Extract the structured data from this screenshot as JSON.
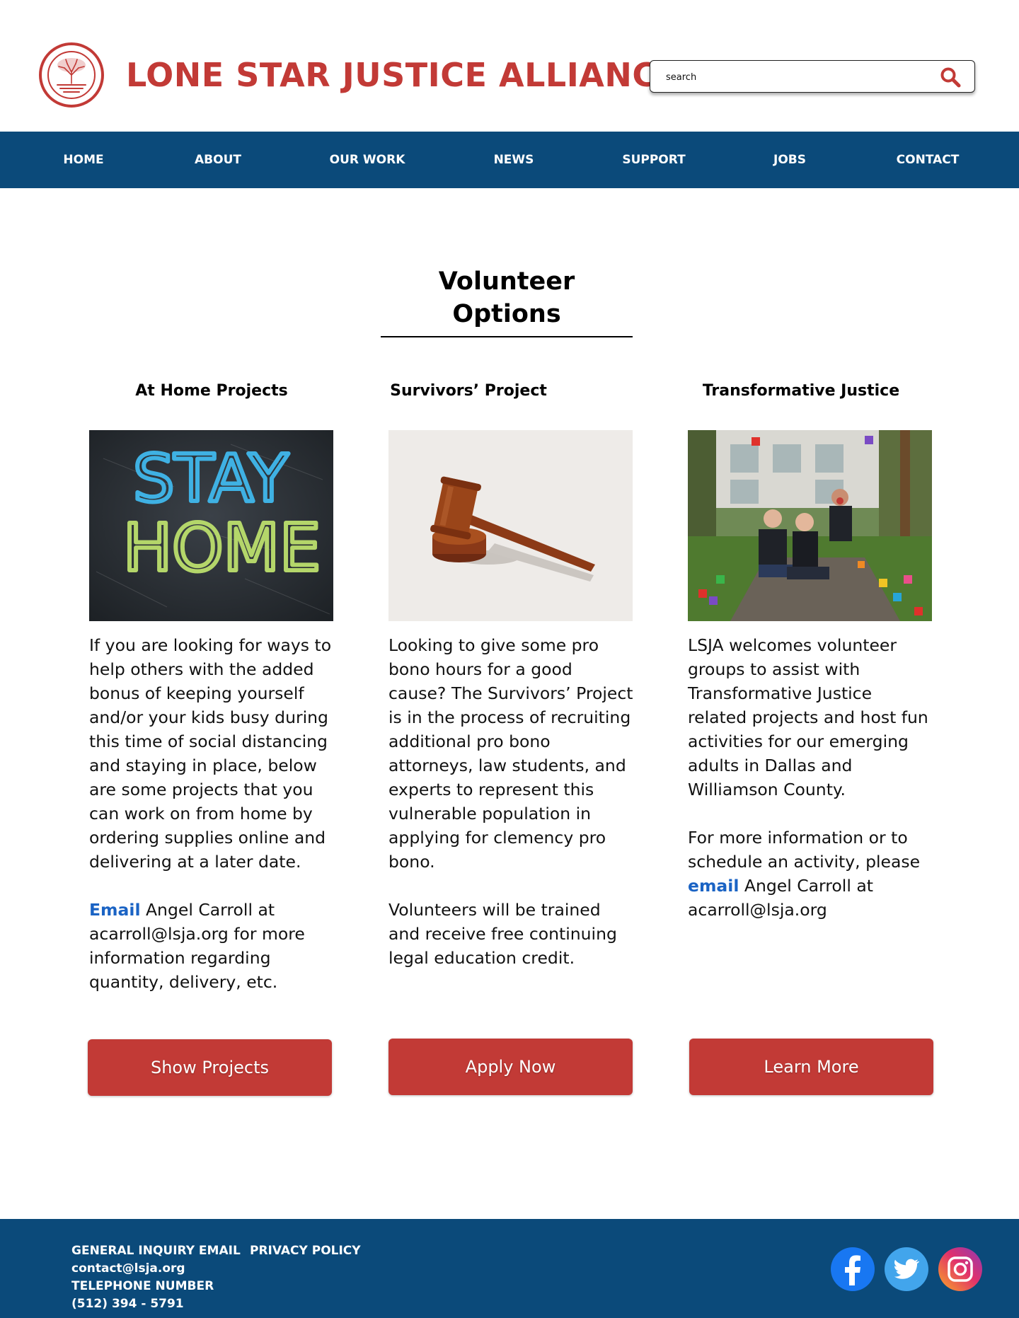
{
  "header": {
    "site_title": "LONE STAR JUSTICE ALLIANCE",
    "search_placeholder": "search"
  },
  "nav": {
    "items": [
      "HOME",
      "ABOUT",
      "OUR WORK",
      "NEWS",
      "SUPPORT",
      "JOBS",
      "CONTACT"
    ]
  },
  "main": {
    "page_title": "Volunteer Options",
    "columns": [
      {
        "title": "At Home Projects",
        "image_text": [
          "STAY",
          "HOME"
        ],
        "paragraph1": "If you are looking for ways to help others with the added bonus of keeping yourself and/or your kids busy during this time of social distancing and staying in place, below are some projects that you can work on from home by ordering supplies online and delivering at a later date.",
        "email_link": "Email",
        "paragraph2_rest": " Angel Carroll at acarroll@lsja.org for more information regarding quantity, delivery, etc.",
        "button": "Show Projects"
      },
      {
        "title": "Survivors’ Project",
        "paragraph1": "Looking to give some pro bono hours for a good cause? The Survivors’ Project is in the process of recruiting additional pro bono attorneys, law students, and experts to represent this vulnerable population in applying for clemency pro bono.",
        "paragraph2": "Volunteers will be trained and receive free continuing legal education credit.",
        "button": "Apply Now"
      },
      {
        "title": "Transformative Justice",
        "paragraph1": "LSJA welcomes volunteer groups to assist with Transformative Justice related projects and host fun activities for our emerging adults in Dallas and Williamson County.",
        "paragraph2_pre": "For more information or to schedule an activity, please ",
        "email_link": "email",
        "paragraph2_rest": " Angel Carroll at acarroll@lsja.org",
        "button": "Learn More"
      }
    ]
  },
  "footer": {
    "general_inquiry_label": "GENERAL INQUIRY EMAIL",
    "privacy_policy": "PRIVACY POLICY",
    "contact_email": "contact@lsja.org",
    "telephone_label": "TELEPHONE NUMBER",
    "telephone": "(512) 394 - 5791",
    "social": [
      "facebook-icon",
      "twitter-icon",
      "instagram-icon"
    ]
  },
  "colors": {
    "brand_red": "#c23a36",
    "nav_blue": "#0b4a7a",
    "link_blue": "#1a63c4"
  }
}
